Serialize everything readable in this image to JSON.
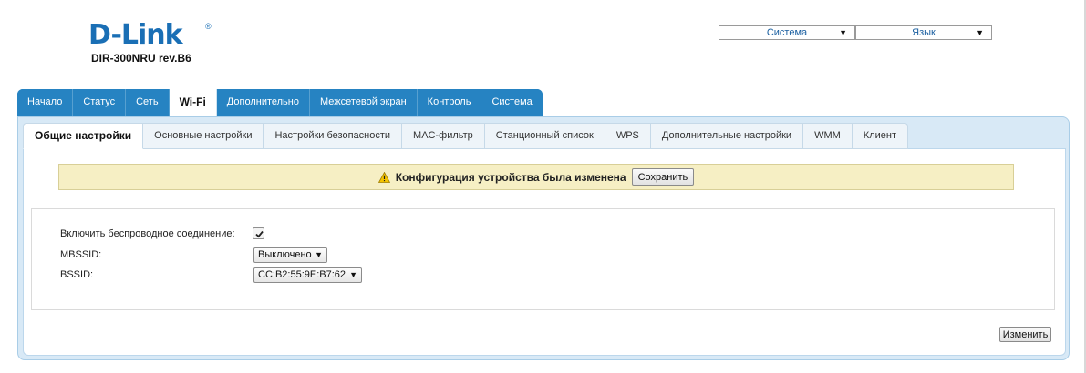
{
  "brand": {
    "logo_text": "D-Link",
    "model": "DIR-300NRU rev.B6"
  },
  "top_menus": {
    "system": {
      "label": "Система"
    },
    "language": {
      "label": "Язык"
    }
  },
  "main_tabs": [
    {
      "label": "Начало"
    },
    {
      "label": "Статус"
    },
    {
      "label": "Сеть"
    },
    {
      "label": "Wi-Fi",
      "active": true
    },
    {
      "label": "Дополнительно"
    },
    {
      "label": "Межсетевой экран"
    },
    {
      "label": "Контроль"
    },
    {
      "label": "Система"
    }
  ],
  "sub_tabs": [
    {
      "label": "Общие настройки",
      "active": true
    },
    {
      "label": "Основные настройки"
    },
    {
      "label": "Настройки безопасности"
    },
    {
      "label": "MAC-фильтр"
    },
    {
      "label": "Станционный список"
    },
    {
      "label": "WPS"
    },
    {
      "label": "Дополнительные настройки"
    },
    {
      "label": "WMM"
    },
    {
      "label": "Клиент"
    }
  ],
  "notice": {
    "message": "Конфигурация устройства была изменена",
    "save_label": "Сохранить"
  },
  "form": {
    "enable_wireless": {
      "label": "Включить беспроводное соединение:",
      "checked": true
    },
    "mbssid": {
      "label": "MBSSID:",
      "value": "Выключено"
    },
    "bssid": {
      "label": "BSSID:",
      "value": "CC:B2:55:9E:B7:62"
    }
  },
  "actions": {
    "change_label": "Изменить"
  },
  "colors": {
    "brand_blue": "#1a6fb5",
    "tab_blue": "#1a78b7",
    "notice_bg": "#f6efc4",
    "warning_yellow": "#f5c400"
  }
}
